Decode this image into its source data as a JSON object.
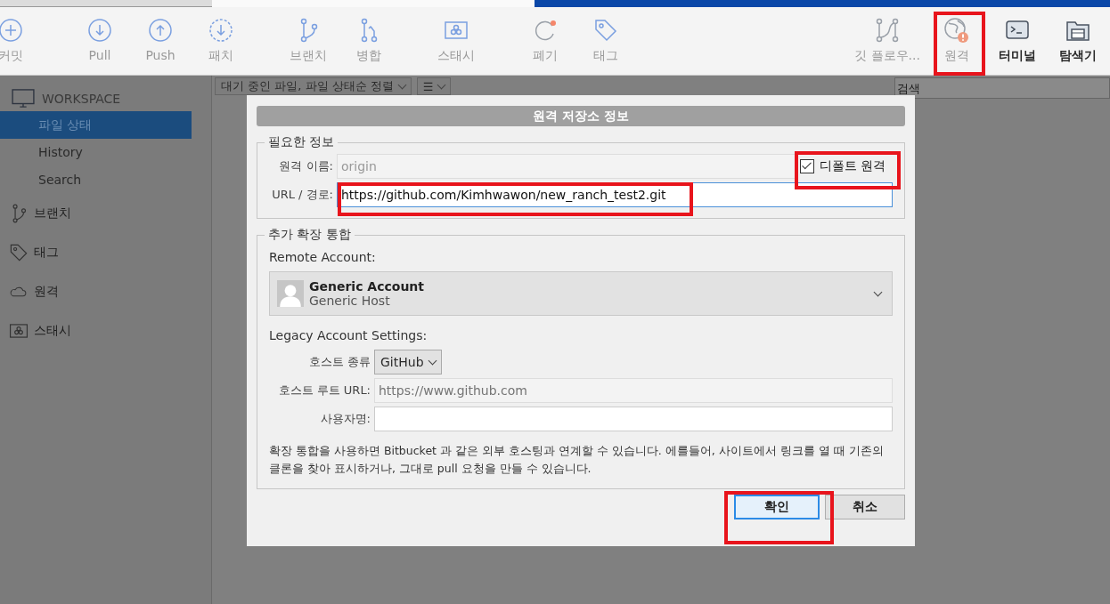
{
  "toolbar": {
    "items": [
      {
        "label": "커밋",
        "disabled": true
      },
      {
        "label": "Pull",
        "disabled": true
      },
      {
        "label": "Push",
        "disabled": true
      },
      {
        "label": "패치",
        "disabled": true
      },
      {
        "label": "브랜치",
        "disabled": true
      },
      {
        "label": "병합",
        "disabled": true
      },
      {
        "label": "스태시",
        "disabled": true
      },
      {
        "label": "폐기",
        "disabled": true
      },
      {
        "label": "태그",
        "disabled": true
      },
      {
        "label": "깃 플로우...",
        "disabled": true
      },
      {
        "label": "원격",
        "disabled": true,
        "alert": true
      },
      {
        "label": "터미널",
        "disabled": false
      },
      {
        "label": "탐색기",
        "disabled": false
      }
    ]
  },
  "sidebar": {
    "header": "WORKSPACE",
    "items": [
      {
        "label": "파일 상태",
        "selected": true
      },
      {
        "label": "History",
        "selected": false
      },
      {
        "label": "Search",
        "selected": false
      }
    ],
    "sections": [
      {
        "label": "브랜치"
      },
      {
        "label": "태그"
      },
      {
        "label": "원격"
      },
      {
        "label": "스태시"
      }
    ]
  },
  "file_view": {
    "sort_dropdown": "대기 중인 파일, 파일 상태순 정렬",
    "view_dropdown": "☰",
    "search": {
      "placeholder": "검색"
    }
  },
  "dialog": {
    "title": "원격 저장소 정보",
    "required": {
      "legend": "필요한 정보",
      "name_label": "원격 이름:",
      "name_value": "origin",
      "default_remote": {
        "label": "디폴트 원격",
        "checked": true
      },
      "url_label": "URL / 경로:",
      "url_value": "https://github.com/Kimhwawon/new_ranch_test2.git"
    },
    "integration": {
      "legend": "추가 확장 통합",
      "account_label": "Remote Account:",
      "account": {
        "name": "Generic Account",
        "host": "Generic Host"
      },
      "legacy_label": "Legacy Account Settings:",
      "host_type_label": "호스트 종류",
      "host_type": "GitHub",
      "host_url_label": "호스트 루트 URL:",
      "host_url_placeholder": "https://www.github.com",
      "username_label": "사용자명:",
      "note": "확장 통합을 사용하면 Bitbucket 과 같은 외부 호스팅과 연계할 수 있습니다. 에를들어, 사이트에서 링크를 열 때 기존의 클론을 찾아 표시하거나, 그대로 pull 요청을 만들 수 있습니다."
    },
    "buttons": [
      {
        "label": "확인",
        "default": true
      },
      {
        "label": "취소",
        "default": false
      }
    ]
  }
}
